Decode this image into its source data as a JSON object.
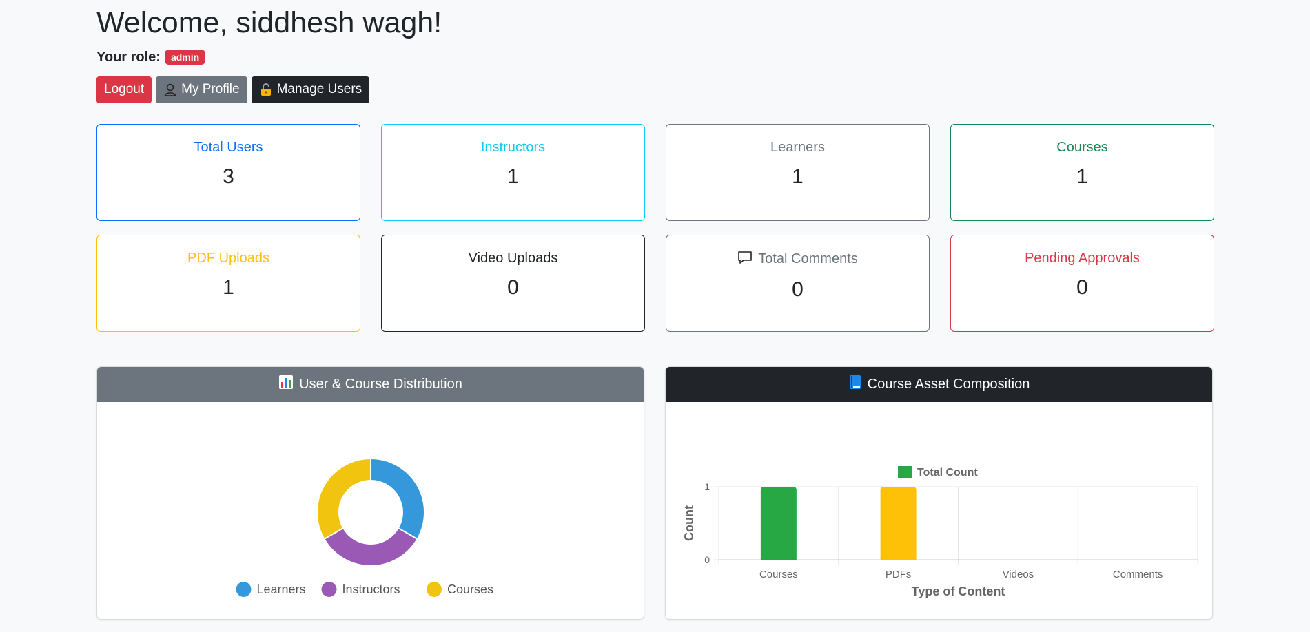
{
  "header": {
    "welcome": "Welcome, siddhesh wagh!",
    "role_label": "Your role:",
    "role_value": "admin"
  },
  "buttons": {
    "logout": "Logout",
    "profile": "My Profile",
    "manage_users": "Manage Users"
  },
  "stats": [
    {
      "title": "Total Users",
      "value": "3",
      "color": "#0d6efd"
    },
    {
      "title": "Instructors",
      "value": "1",
      "color": "#0dcaf0"
    },
    {
      "title": "Learners",
      "value": "1",
      "color": "#6c757d"
    },
    {
      "title": "Courses",
      "value": "1",
      "color": "#198754"
    },
    {
      "title": "PDF Uploads",
      "value": "1",
      "color": "#ffc107"
    },
    {
      "title": "Video Uploads",
      "value": "0",
      "color": "#212529"
    },
    {
      "title": "Total Comments",
      "value": "0",
      "color": "#6c757d",
      "icon": "chat-icon"
    },
    {
      "title": "Pending Approvals",
      "value": "0",
      "color": "#dc3545"
    }
  ],
  "charts": {
    "distribution_title": "User & Course Distribution",
    "distribution_icon": "bar-chart-icon",
    "distribution_header_color": "#6c757d",
    "composition_title": "Course Asset Composition",
    "composition_icon": "book-icon",
    "composition_header_color": "#212529"
  },
  "chart_data": [
    {
      "type": "pie",
      "variant": "doughnut",
      "labels": [
        "Learners",
        "Instructors",
        "Courses"
      ],
      "values": [
        1,
        1,
        1
      ],
      "colors": [
        "#3498db",
        "#9b59b6",
        "#f1c40f"
      ],
      "legend": "bottom"
    },
    {
      "type": "bar",
      "categories": [
        "Courses",
        "PDFs",
        "Videos",
        "Comments"
      ],
      "series": [
        {
          "name": "Total Count",
          "values": [
            1,
            1,
            0,
            0
          ]
        }
      ],
      "bar_colors": [
        "#28a745",
        "#ffc107",
        "#dc3545",
        "#17a2b8"
      ],
      "legend_color": "#28a745",
      "xlabel": "Type of Content",
      "ylabel": "Count",
      "ylim": [
        0,
        1
      ],
      "yticks": [
        "0",
        "1"
      ],
      "grid": true,
      "legend": "top"
    }
  ]
}
